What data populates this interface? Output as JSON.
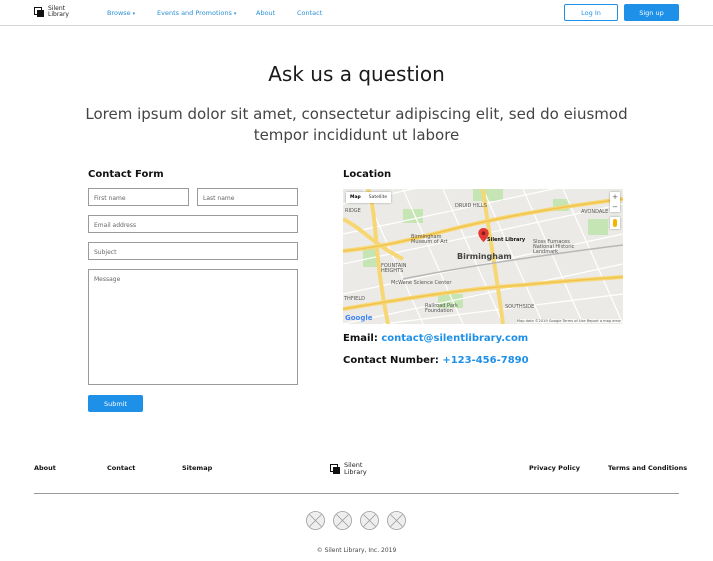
{
  "header": {
    "logo_text_line1": "Silent",
    "logo_text_line2": "Library",
    "nav": [
      {
        "label": "Browse",
        "has_caret": true
      },
      {
        "label": "Events and Promotions",
        "has_caret": true
      },
      {
        "label": "About",
        "has_caret": false
      },
      {
        "label": "Contact",
        "has_caret": false
      }
    ],
    "caret": "▾",
    "login_label": "Log In",
    "signup_label": "Sign up"
  },
  "hero": {
    "title": "Ask us a question",
    "subtitle": "Lorem ipsum dolor sit amet, consectetur adipiscing elit, sed do eiusmod tempor incididunt ut labore"
  },
  "contact_form": {
    "heading": "Contact Form",
    "first_name_placeholder": "First name",
    "last_name_placeholder": "Last name",
    "email_placeholder": "Email address",
    "subject_placeholder": "Subject",
    "message_placeholder": "Message",
    "submit_label": "Submit"
  },
  "location": {
    "heading": "Location",
    "map": {
      "map_toggle": "Map",
      "satellite_toggle": "Satellite",
      "zoom_in": "+",
      "zoom_out": "−",
      "city": "Birmingham",
      "place_label": "Silent Library",
      "labels": {
        "druid_hills": "DRUID HILLS",
        "ridge": "RIDGE",
        "museum": "Birmingham Museum of Art",
        "fountain_heights": "FOUNTAIN HEIGHTS",
        "mcwane": "McWane Science Center",
        "furnaces": "Sloss Furnaces National Historic Landmark",
        "avondale": "AVONDALE",
        "southside": "SOUTHSIDE",
        "railroad": "Railroad Park Foundation",
        "thfield": "THFIELD"
      },
      "google": "Google",
      "attribution": "Map data ©2019 Google   Terms of Use   Report a map error"
    },
    "email_label": "Email:",
    "email_value": "contact@silentlibrary.com",
    "phone_label": "Contact Number:",
    "phone_value": "+123-456-7890"
  },
  "footer": {
    "links_left": [
      "About",
      "Contact",
      "Sitemap"
    ],
    "logo_text_line1": "Silent",
    "logo_text_line2": "Library",
    "links_right": [
      "Privacy Policy",
      "Terms and Conditions"
    ],
    "social_icons": [
      "social-icon-1",
      "social-icon-2",
      "social-icon-3",
      "social-icon-4"
    ],
    "copyright": "© Silent Library, Inc. 2019"
  },
  "colors": {
    "accent": "#1e90e8",
    "nav_link": "#2b8fd6",
    "map_road": "#f7d774",
    "map_park": "#c5e6b4",
    "pin": "#e53935"
  }
}
